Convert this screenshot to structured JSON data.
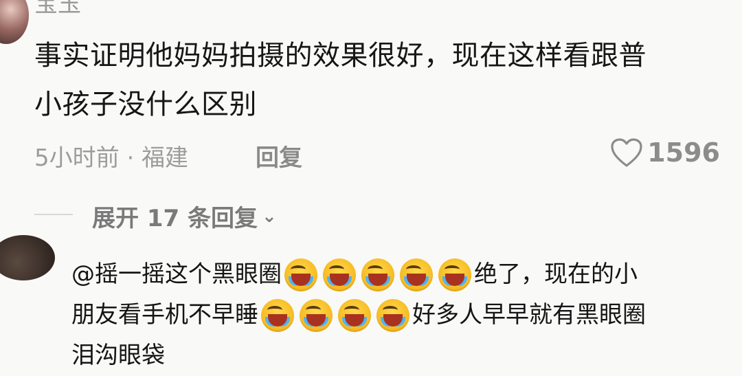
{
  "comment1": {
    "username": "宝玉",
    "text_line1": "事实证明他妈妈拍摄的效果很好，现在这样看跟普",
    "text_line2": "小孩子没什么区别",
    "meta": "5小时前 · 福建",
    "reply_label": "回复",
    "likes": "1596",
    "expand_label": "展开 17 条回复"
  },
  "comment2": {
    "line1_a": "@摇一摇这个黑眼圈",
    "line1_b": "绝了，现在的小",
    "line2_a": "朋友看手机不早睡",
    "line2_b": "好多人早早就有黑眼圈",
    "line3": "泪沟眼袋",
    "emoji_name": "laughing-crying-emoji"
  },
  "colors": {
    "background": "#f9f9f7",
    "text_primary": "#161616",
    "text_secondary": "#9c9c9c"
  }
}
